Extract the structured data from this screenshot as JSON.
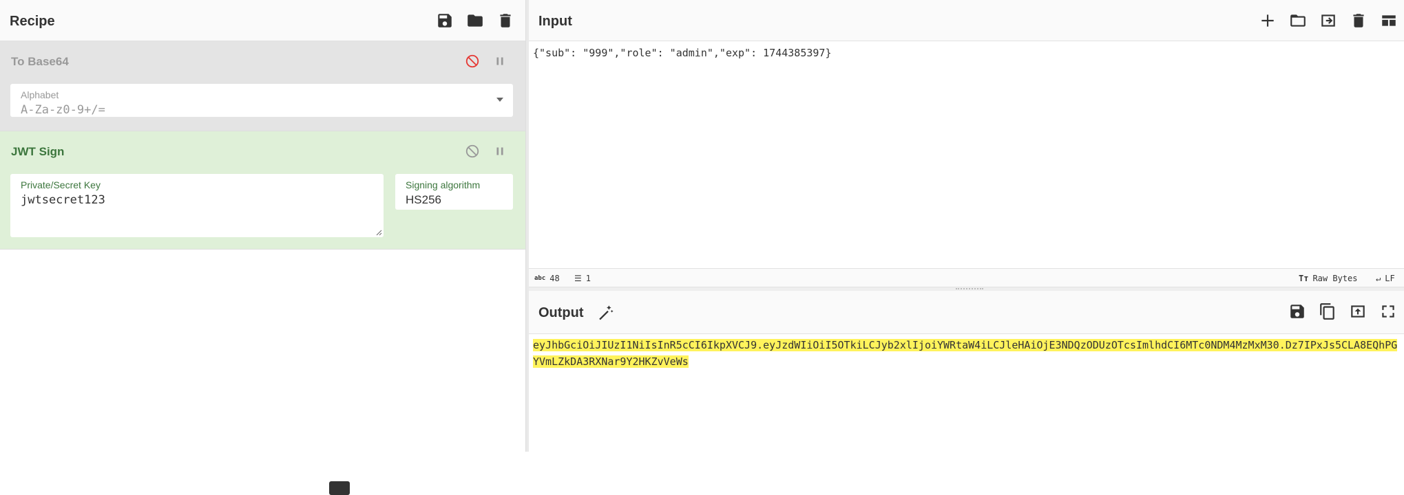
{
  "recipe": {
    "title": "Recipe",
    "operations": [
      {
        "name": "To Base64",
        "field_label": "Alphabet",
        "field_value": "A-Za-z0-9+/="
      },
      {
        "name": "JWT Sign",
        "key_label": "Private/Secret Key",
        "key_value": "jwtsecret123",
        "alg_label": "Signing algorithm",
        "alg_value": "HS256"
      }
    ]
  },
  "input": {
    "title": "Input",
    "text": "{\"sub\": \"999\",\"role\": \"admin\",\"exp\": 1744385397}",
    "status": {
      "chars": "48",
      "lines": "1",
      "encoding": "Raw Bytes",
      "eol": "LF"
    }
  },
  "output": {
    "title": "Output",
    "text": "eyJhbGciOiJIUzI1NiIsInR5cCI6IkpXVCJ9.eyJzdWIiOiI5OTkiLCJyb2xlIjoiYWRtaW4iLCJleHAiOjE3NDQzODUzOTcsImlhdCI6MTc0NDM4MzMxM30.Dz7IPxJs5CLA8EQhPGYVmLZkDA3RXNar9Y2HKZvVeWs"
  },
  "colors": {
    "disabled_op_bg": "#e4e4e4",
    "active_op_bg": "#dff0d8",
    "active_op_text": "#3c763d",
    "highlight": "#fff35c",
    "disabled_icon": "#e53935"
  }
}
